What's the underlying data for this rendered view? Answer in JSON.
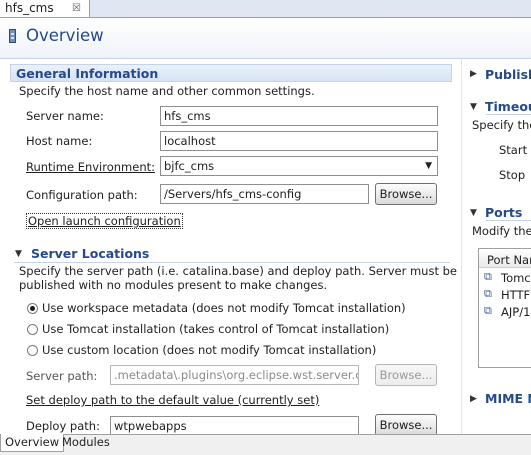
{
  "editor_tab": {
    "title": "hfs_cms",
    "close": "☒"
  },
  "form": {
    "title": "Overview"
  },
  "general": {
    "title": "General Information",
    "description": "Specify the host name and other common settings.",
    "server_name_label": "Server name:",
    "server_name_value": "hfs_cms",
    "host_name_label": "Host name:",
    "host_name_value": "localhost",
    "runtime_label": "Runtime Environment:",
    "runtime_value": "bjfc_cms",
    "config_path_label": "Configuration path:",
    "config_path_value": "/Servers/hfs_cms-config",
    "browse_label": "Browse...",
    "open_launch_link": "Open launch configuration"
  },
  "locations": {
    "title": "Server Locations",
    "description_line1": "Specify the server path (i.e. catalina.base) and deploy path. Server must be",
    "description_line2": "published with no modules present to make changes.",
    "option1": "Use workspace metadata (does not modify Tomcat installation)",
    "option2": "Use Tomcat installation (takes control of Tomcat installation)",
    "option3": "Use custom location (does not modify Tomcat installation)",
    "selected": "option1",
    "server_path_label": "Server path:",
    "server_path_value": ".metadata\\.plugins\\org.eclipse.wst.server.co",
    "browse_label": "Browse...",
    "set_deploy_link": "Set deploy path to the default value (currently set)",
    "deploy_path_label": "Deploy path:",
    "deploy_path_value": "wtpwebapps",
    "deploy_browse_label": "Browse..."
  },
  "right": {
    "publishing_title": "Publishi",
    "timeouts_title": "Timeout",
    "timeouts_desc": "Specify the",
    "start_label": "Start",
    "stop_label": "Stop",
    "ports_title": "Ports",
    "ports_desc": "Modify the",
    "ports_column": "Port Nam",
    "port_rows": [
      "Tomc",
      "HTTF",
      "AJP/1"
    ],
    "mime_title": "MIME M"
  },
  "bottom_tabs": [
    "Overview",
    "Modules"
  ],
  "colors": {
    "section_title": "#25498a",
    "tab_strip": "#dfe7f3"
  },
  "icons": {
    "collapse": "▼",
    "expand": "▶",
    "dropdown": "▼",
    "port": "⧉"
  }
}
